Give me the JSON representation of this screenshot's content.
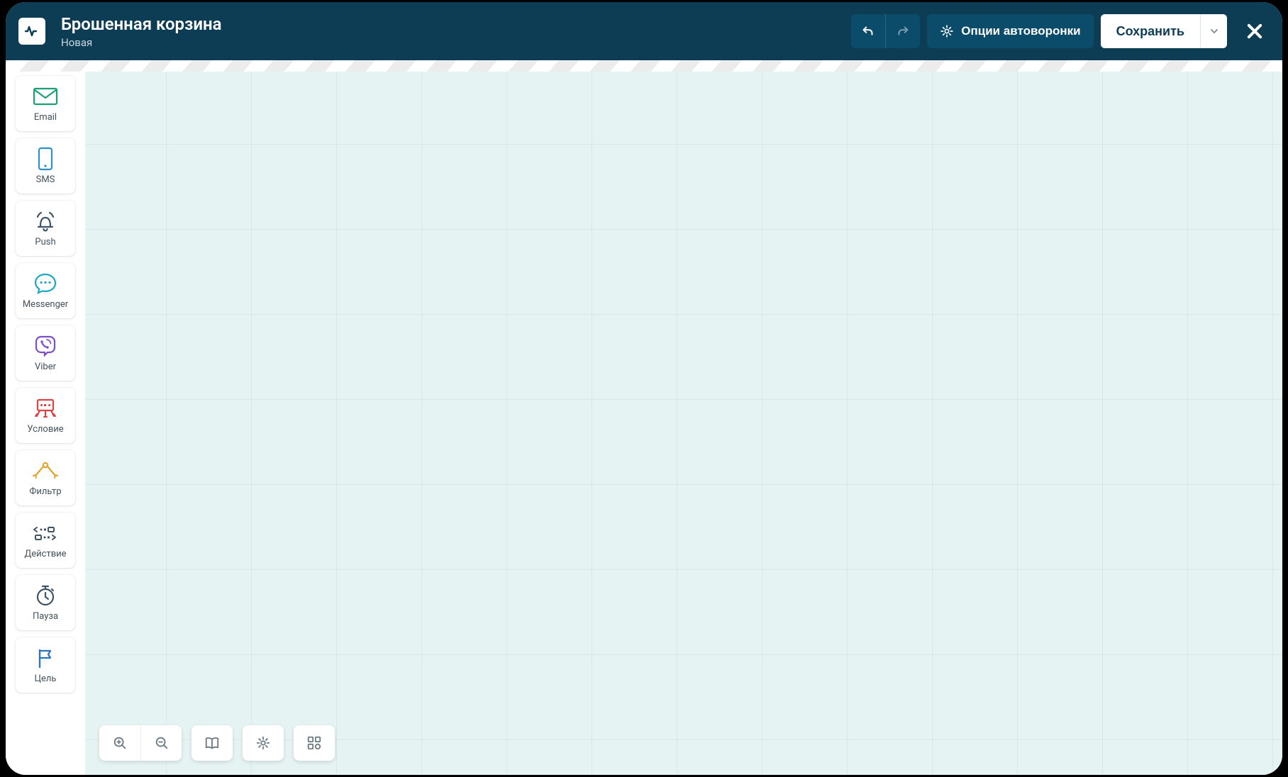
{
  "header": {
    "title": "Брошенная корзина",
    "subtitle": "Новая",
    "options_label": "Опции автоворонки",
    "save_label": "Сохранить"
  },
  "sidebar": {
    "items": [
      {
        "label": "Email"
      },
      {
        "label": "SMS"
      },
      {
        "label": "Push"
      },
      {
        "label": "Messenger"
      },
      {
        "label": "Viber"
      },
      {
        "label": "Условие"
      },
      {
        "label": "Фильтр"
      },
      {
        "label": "Действие"
      },
      {
        "label": "Пауза"
      },
      {
        "label": "Цель"
      }
    ]
  },
  "colors": {
    "header_bg": "#0d3d55",
    "accent_teal": "#1aa69a",
    "canvas_bg": "#e6f3f3"
  }
}
